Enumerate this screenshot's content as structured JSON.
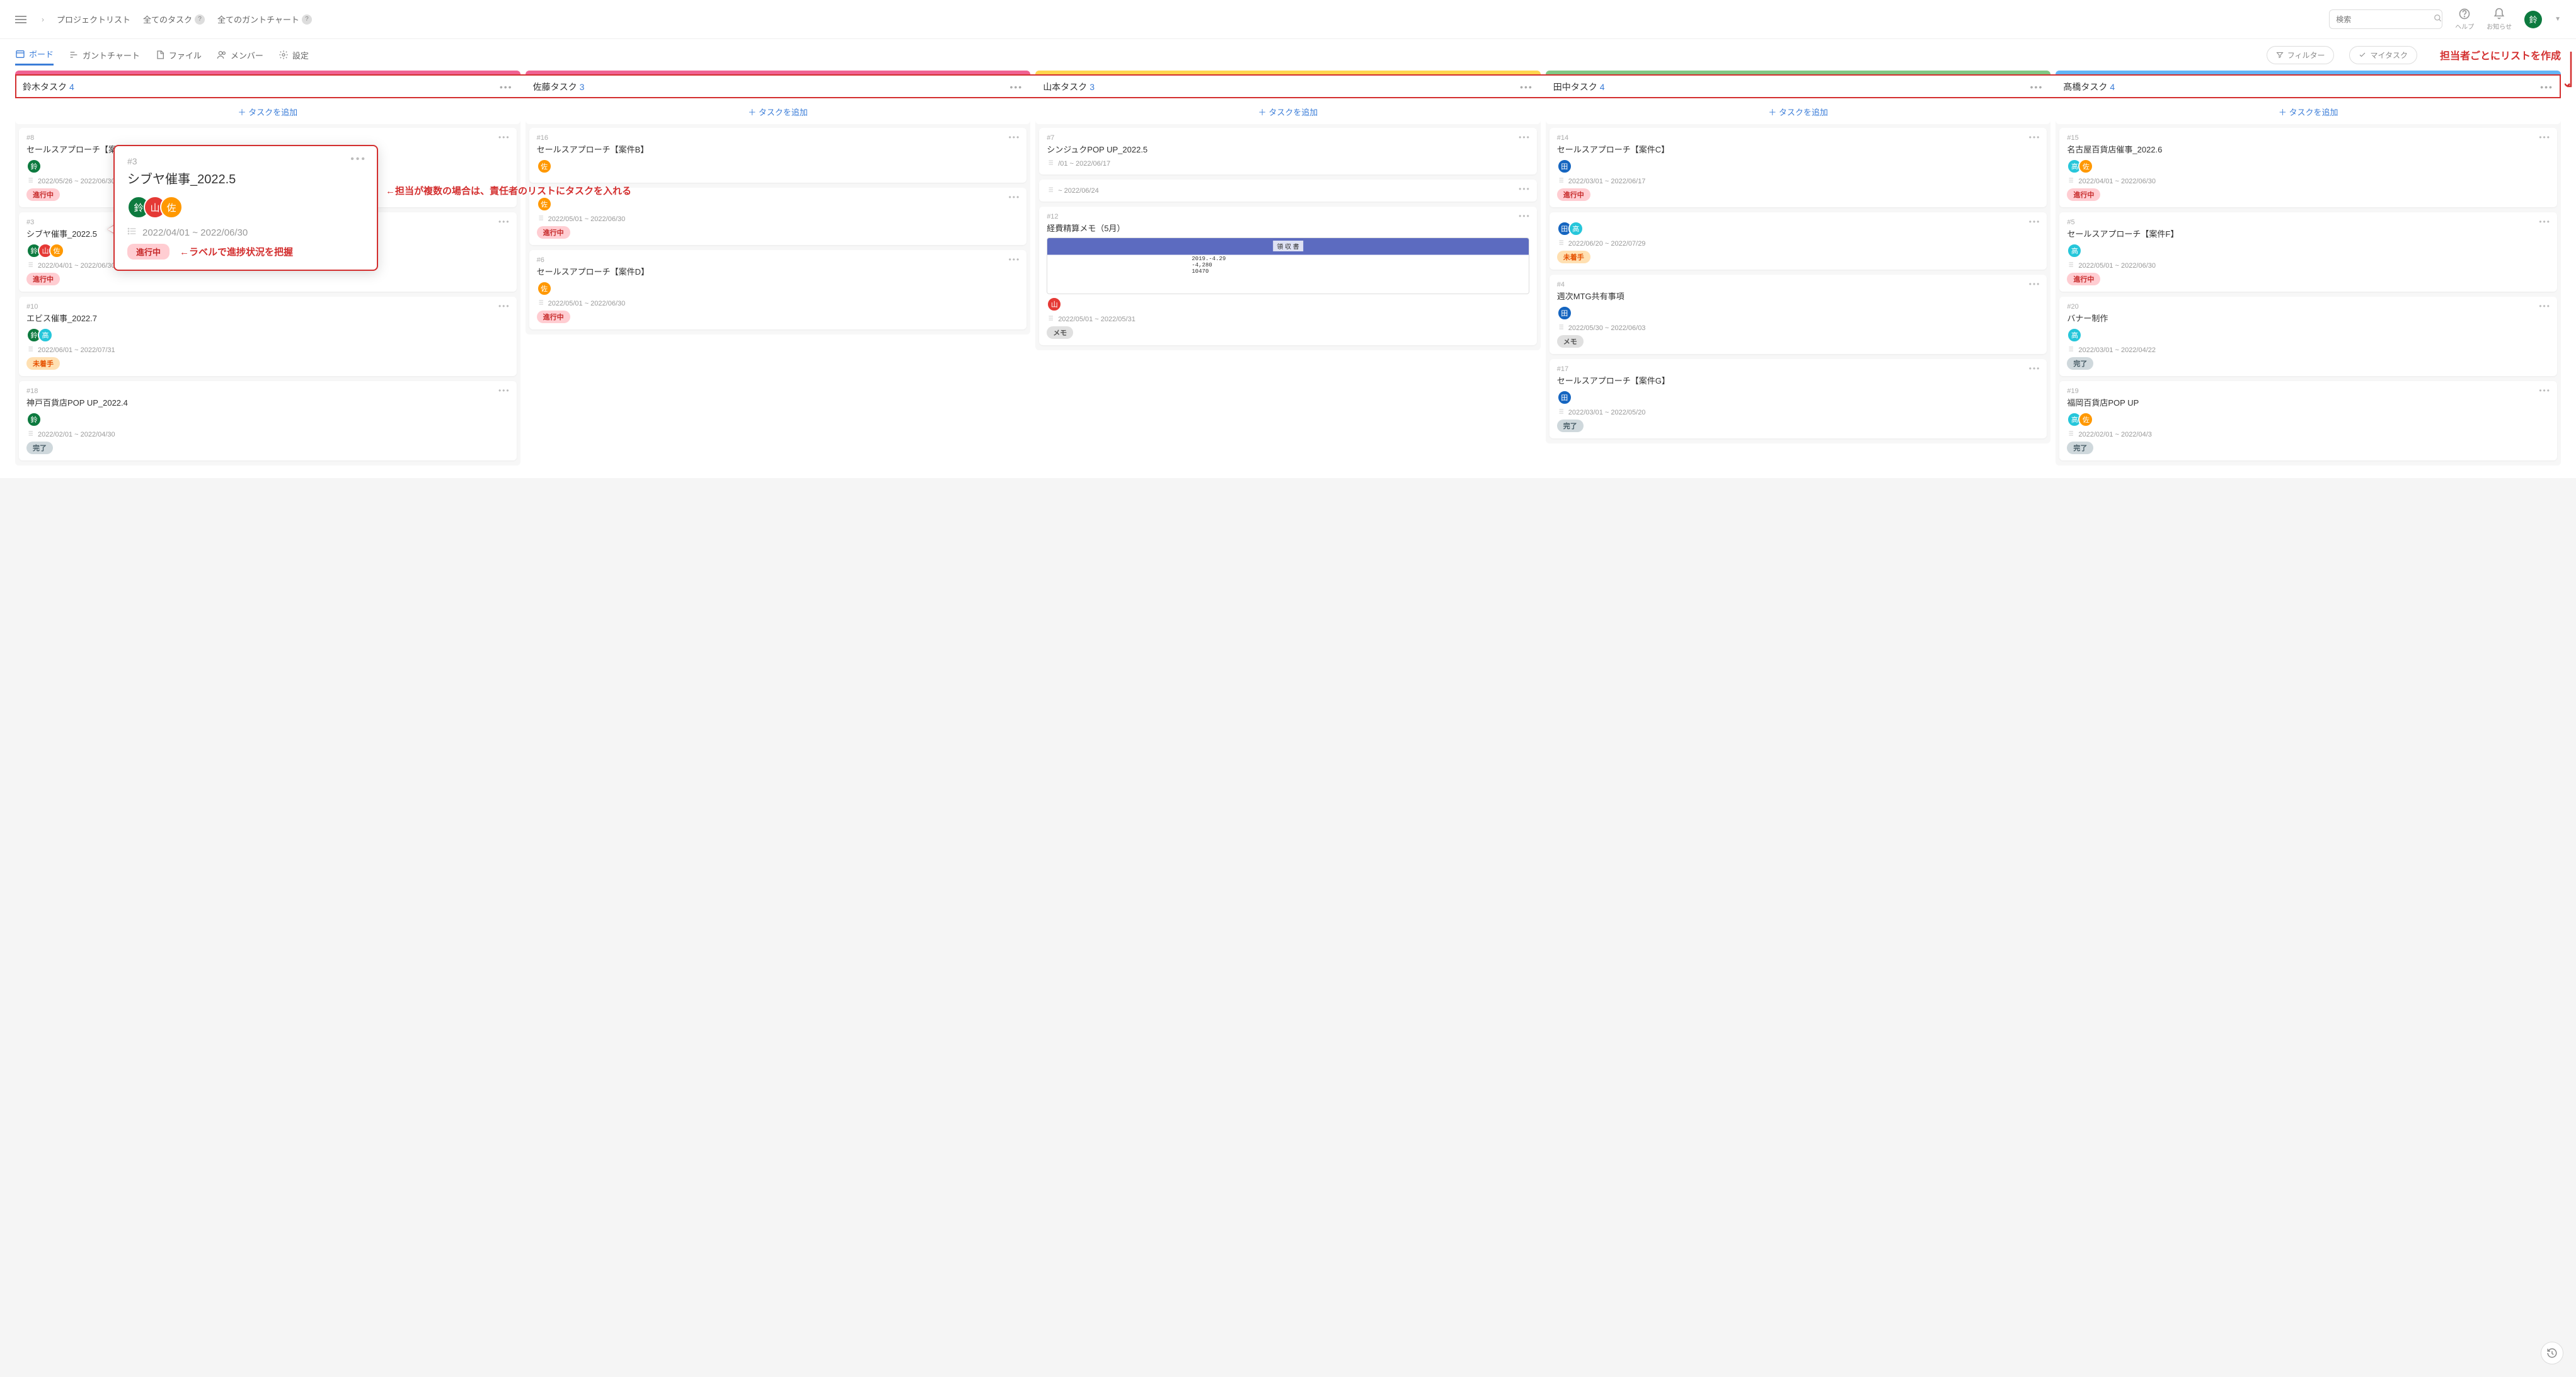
{
  "topnav": {
    "project_list": "プロジェクトリスト",
    "all_tasks": "全てのタスク",
    "all_gantt": "全てのガントチャート"
  },
  "search": {
    "placeholder": "検索"
  },
  "help": {
    "label": "ヘルプ"
  },
  "notify": {
    "label": "お知らせ"
  },
  "user": {
    "initial": "鈴"
  },
  "tabs": {
    "board": "ボード",
    "gantt": "ガントチャート",
    "file": "ファイル",
    "member": "メンバー",
    "settings": "設定",
    "filter": "フィルター",
    "mytask": "マイタスク"
  },
  "annotations": {
    "top_right": "担当者ごとにリストを作成",
    "popup_assignees": "←担当が複数の場合は、責任者のリストにタスクを入れる",
    "popup_label": "←ラベルで進捗状況を把握"
  },
  "addtask_label": "＋ タスクを追加",
  "columns": [
    {
      "title": "鈴木タスク",
      "count": "4",
      "strip": "pink",
      "cards": [
        {
          "id": "#8",
          "title": "セールスアプローチ【案件A】",
          "avatars": [
            "suzu"
          ],
          "date": "2022/05/26 ~ 2022/06/30",
          "tag": "progress",
          "tag_label": "進行中"
        },
        {
          "id": "#3",
          "title": "シブヤ催事_2022.5",
          "avatars": [
            "suzu",
            "yama",
            "sato"
          ],
          "date": "2022/04/01 ~ 2022/06/30",
          "tag": "progress",
          "tag_label": "進行中"
        },
        {
          "id": "#10",
          "title": "エビス催事_2022.7",
          "avatars": [
            "suzu",
            "taka"
          ],
          "date": "2022/06/01 ~ 2022/07/31",
          "tag": "notyet",
          "tag_label": "未着手"
        },
        {
          "id": "#18",
          "title": "神戸百貨店POP UP_2022.4",
          "avatars": [
            "suzu"
          ],
          "date": "2022/02/01 ~ 2022/04/30",
          "tag": "done",
          "tag_label": "完了"
        }
      ]
    },
    {
      "title": "佐藤タスク",
      "count": "3",
      "strip": "pink",
      "cards": [
        {
          "id": "#16",
          "title": "セールスアプローチ【案件B】",
          "avatars": [
            "sato"
          ],
          "date": "",
          "tag": "",
          "tag_label": ""
        },
        {
          "id": "",
          "title": "",
          "avatars": [
            "sato"
          ],
          "date": "2022/05/01 ~ 2022/06/30",
          "tag": "progress",
          "tag_label": "進行中"
        },
        {
          "id": "#6",
          "title": "セールスアプローチ【案件D】",
          "avatars": [
            "sato"
          ],
          "date": "2022/05/01 ~ 2022/06/30",
          "tag": "progress",
          "tag_label": "進行中"
        }
      ]
    },
    {
      "title": "山本タスク",
      "count": "3",
      "strip": "yellow",
      "cards": [
        {
          "id": "#7",
          "title": "シンジュクPOP UP_2022.5",
          "avatars": [],
          "date": "/01 ~ 2022/06/17",
          "tag": "",
          "tag_label": ""
        },
        {
          "id": "",
          "title": "",
          "avatars": [],
          "date": "~ 2022/06/24",
          "tag": "",
          "tag_label": ""
        },
        {
          "id": "#12",
          "title": "経費精算メモ（5月）",
          "avatars": [
            "yama"
          ],
          "date": "2022/05/01 ~ 2022/05/31",
          "tag": "memo",
          "tag_label": "メモ",
          "has_thumb": true
        }
      ]
    },
    {
      "title": "田中タスク",
      "count": "4",
      "strip": "green",
      "cards": [
        {
          "id": "#14",
          "title": "セールスアプローチ【案件C】",
          "avatars": [
            "tana"
          ],
          "date": "2022/03/01 ~ 2022/06/17",
          "tag": "progress",
          "tag_label": "進行中"
        },
        {
          "id": "",
          "title": "",
          "avatars": [
            "tana",
            "taka"
          ],
          "date": "2022/06/20 ~ 2022/07/29",
          "tag": "notyet",
          "tag_label": "未着手"
        },
        {
          "id": "#4",
          "title": "週次MTG共有事項",
          "avatars": [
            "tana"
          ],
          "date": "2022/05/30 ~ 2022/06/03",
          "tag": "memo",
          "tag_label": "メモ"
        },
        {
          "id": "#17",
          "title": "セールスアプローチ【案件G】",
          "avatars": [
            "tana"
          ],
          "date": "2022/03/01 ~ 2022/05/20",
          "tag": "done",
          "tag_label": "完了"
        }
      ]
    },
    {
      "title": "髙橋タスク",
      "count": "4",
      "strip": "blue",
      "cards": [
        {
          "id": "#15",
          "title": "名古屋百貨店催事_2022.6",
          "avatars": [
            "taka",
            "sato"
          ],
          "date": "2022/04/01 ~ 2022/06/30",
          "tag": "progress",
          "tag_label": "進行中"
        },
        {
          "id": "#5",
          "title": "セールスアプローチ【案件F】",
          "avatars": [
            "taka"
          ],
          "date": "2022/05/01 ~ 2022/06/30",
          "tag": "progress",
          "tag_label": "進行中"
        },
        {
          "id": "#20",
          "title": "バナー制作",
          "avatars": [
            "taka"
          ],
          "date": "2022/03/01 ~ 2022/04/22",
          "tag": "done",
          "tag_label": "完了"
        },
        {
          "id": "#19",
          "title": "福岡百貨店POP UP",
          "avatars": [
            "taka",
            "sato"
          ],
          "date": "2022/02/01 ~ 2022/04/3",
          "tag": "done",
          "tag_label": "完了"
        }
      ]
    }
  ],
  "popup": {
    "id": "#3",
    "title": "シブヤ催事_2022.5",
    "avatars": [
      "suzu",
      "yama",
      "sato"
    ],
    "date": "2022/04/01 ~ 2022/06/30",
    "tag_label": "進行中"
  },
  "avatar_initials": {
    "suzu": "鈴",
    "yama": "山",
    "sato": "佐",
    "tana": "田",
    "taka": "高"
  }
}
